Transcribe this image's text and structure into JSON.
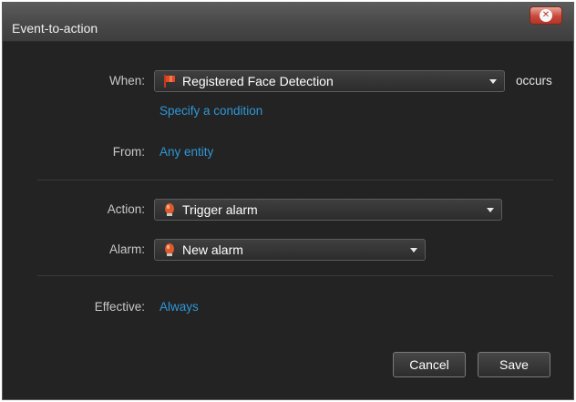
{
  "window": {
    "title": "Event-to-action"
  },
  "fields": {
    "when": {
      "label": "When:",
      "value": "Registered Face Detection",
      "icon": "flag-icon",
      "suffix": "occurs",
      "condition_link": "Specify a condition"
    },
    "from": {
      "label": "From:",
      "value": "Any entity"
    },
    "action": {
      "label": "Action:",
      "value": "Trigger alarm",
      "icon": "alarm-bulb-icon"
    },
    "alarm": {
      "label": "Alarm:",
      "value": "New alarm",
      "icon": "alarm-bulb-icon"
    },
    "effective": {
      "label": "Effective:",
      "value": "Always"
    }
  },
  "buttons": {
    "cancel": "Cancel",
    "save": "Save"
  },
  "colors": {
    "link": "#2f97d8",
    "background": "#232323",
    "close_button": "#c8483a",
    "flag_icon": "#d84a2a",
    "alarm_icon": "#e05a2a"
  }
}
